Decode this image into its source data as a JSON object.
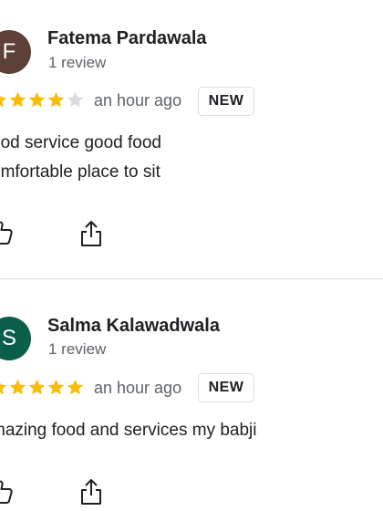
{
  "reviews": [
    {
      "avatar_letter": "F",
      "avatar_color": "#5d4037",
      "name": "Fatema Pardawala",
      "review_count": "1 review",
      "rating": 4,
      "max_rating": 5,
      "time": "an hour ago",
      "badge": "NEW",
      "text_lines": [
        "ood service good food",
        "omfortable place to sit"
      ],
      "actions": [
        "thumbs-up-icon",
        "share-icon"
      ]
    },
    {
      "avatar_letter": "S",
      "avatar_color": "#0b5e4a",
      "name": "Salma Kalawadwala",
      "review_count": "1 review",
      "rating": 5,
      "max_rating": 5,
      "time": "an hour ago",
      "badge": "NEW",
      "text_lines": [
        "mazing food and services my babji"
      ],
      "actions": [
        "thumbs-up-icon",
        "share-icon"
      ]
    }
  ],
  "colors": {
    "star_filled": "#fbbc04",
    "star_empty": "#dadce0",
    "divider": "#dadce0"
  }
}
